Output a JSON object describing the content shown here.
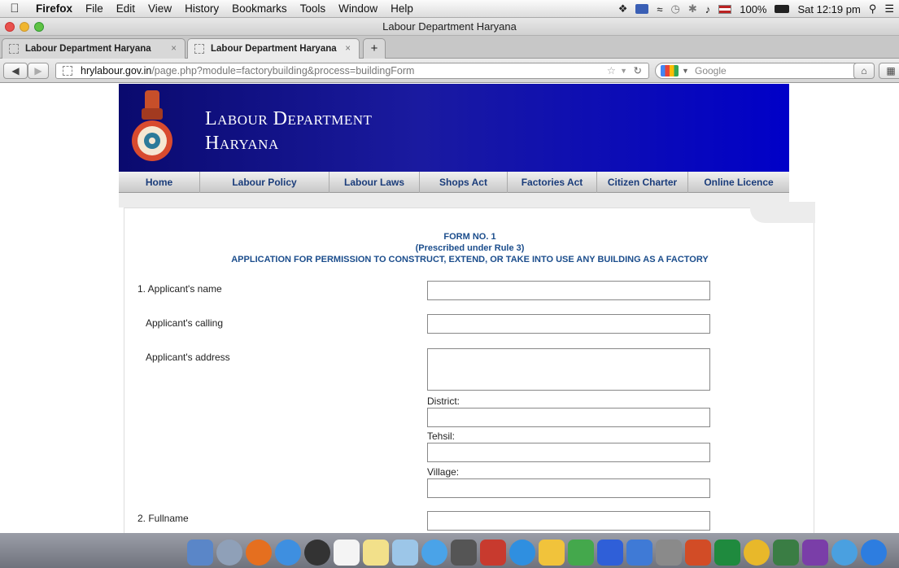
{
  "menubar": {
    "app": "Firefox",
    "items": [
      "File",
      "Edit",
      "View",
      "History",
      "Bookmarks",
      "Tools",
      "Window",
      "Help"
    ],
    "battery": "100%",
    "clock": "Sat 12:19 pm"
  },
  "window": {
    "title": "Labour Department Haryana"
  },
  "tabs": [
    {
      "label": "Labour Department Haryana"
    },
    {
      "label": "Labour Department Haryana"
    }
  ],
  "nav": {
    "url_domain": "hrylabour.gov.in",
    "url_path": "/page.php?module=factorybuilding&process=buildingForm",
    "search_placeholder": "Google"
  },
  "site": {
    "title_line1": "Labour Department",
    "title_line2": "Haryana",
    "nav": [
      "Home",
      "Labour Policy",
      "Labour Laws",
      "Shops Act",
      "Factories Act",
      "Citizen Charter",
      "Online Licence"
    ]
  },
  "form": {
    "title1": "FORM NO. 1",
    "title2": "(Prescribed under Rule 3)",
    "title3": "APPLICATION FOR PERMISSION TO CONSTRUCT, EXTEND, OR TAKE INTO USE ANY BUILDING AS A FACTORY",
    "applicant_name_label": "1. Applicant's name",
    "applicant_calling_label": "Applicant's calling",
    "applicant_address_label": "Applicant's address",
    "district_label": "District:",
    "tehsil_label": "Tehsil:",
    "village_label": "Village:",
    "fullname_label": "2. Fullname"
  },
  "colors": {
    "header_blue": "#0000c8",
    "nav_text": "#1a3c7a",
    "form_title": "#1b4d8c"
  }
}
